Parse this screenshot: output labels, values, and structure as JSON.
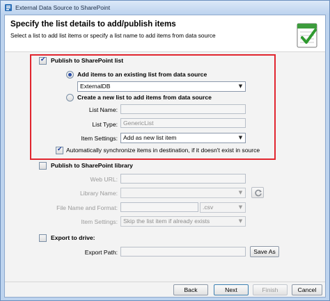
{
  "window": {
    "title": "External Data Source to SharePoint"
  },
  "header": {
    "title": "Specify the list details to add/publish items",
    "subtitle": "Select a list to add list items or specify a list name to add items from data source"
  },
  "publish_list": {
    "label": "Publish to SharePoint list",
    "checked": true,
    "existing": {
      "label": "Add items to an existing list from data source",
      "selected": true,
      "value": "ExternalDB"
    },
    "new_list": {
      "label": "Create a new list to add items from data source",
      "selected": false
    },
    "list_name": {
      "label": "List Name:",
      "value": ""
    },
    "list_type": {
      "label": "List Type:",
      "value": "GenericList"
    },
    "item_settings": {
      "label": "Item Settings:",
      "value": "Add as new list item"
    },
    "auto_sync": {
      "label": "Automatically synchronize items in destination, if it doesn't exist in source",
      "checked": true
    }
  },
  "publish_library": {
    "label": "Publish to SharePoint library",
    "checked": false,
    "web_url": {
      "label": "Web URL:",
      "value": ""
    },
    "library_name": {
      "label": "Library Name:",
      "value": ""
    },
    "file_name_format": {
      "label": "File Name and Format:",
      "value": "",
      "extension": ".csv"
    },
    "item_settings": {
      "label": "Item Settings:",
      "value": "Skip the list item if already exists"
    }
  },
  "export_drive": {
    "label": "Export to drive:",
    "checked": false,
    "export_path": {
      "label": "Export Path:",
      "value": ""
    },
    "save_as_label": "Save As"
  },
  "footer": {
    "back_label": "Back",
    "next_label": "Next",
    "finish_label": "Finish",
    "cancel_label": "Cancel"
  },
  "colors": {
    "highlight_border": "#e1252e",
    "radio_dot": "#2a4ea8",
    "title_bar": "#bcd2ee"
  }
}
